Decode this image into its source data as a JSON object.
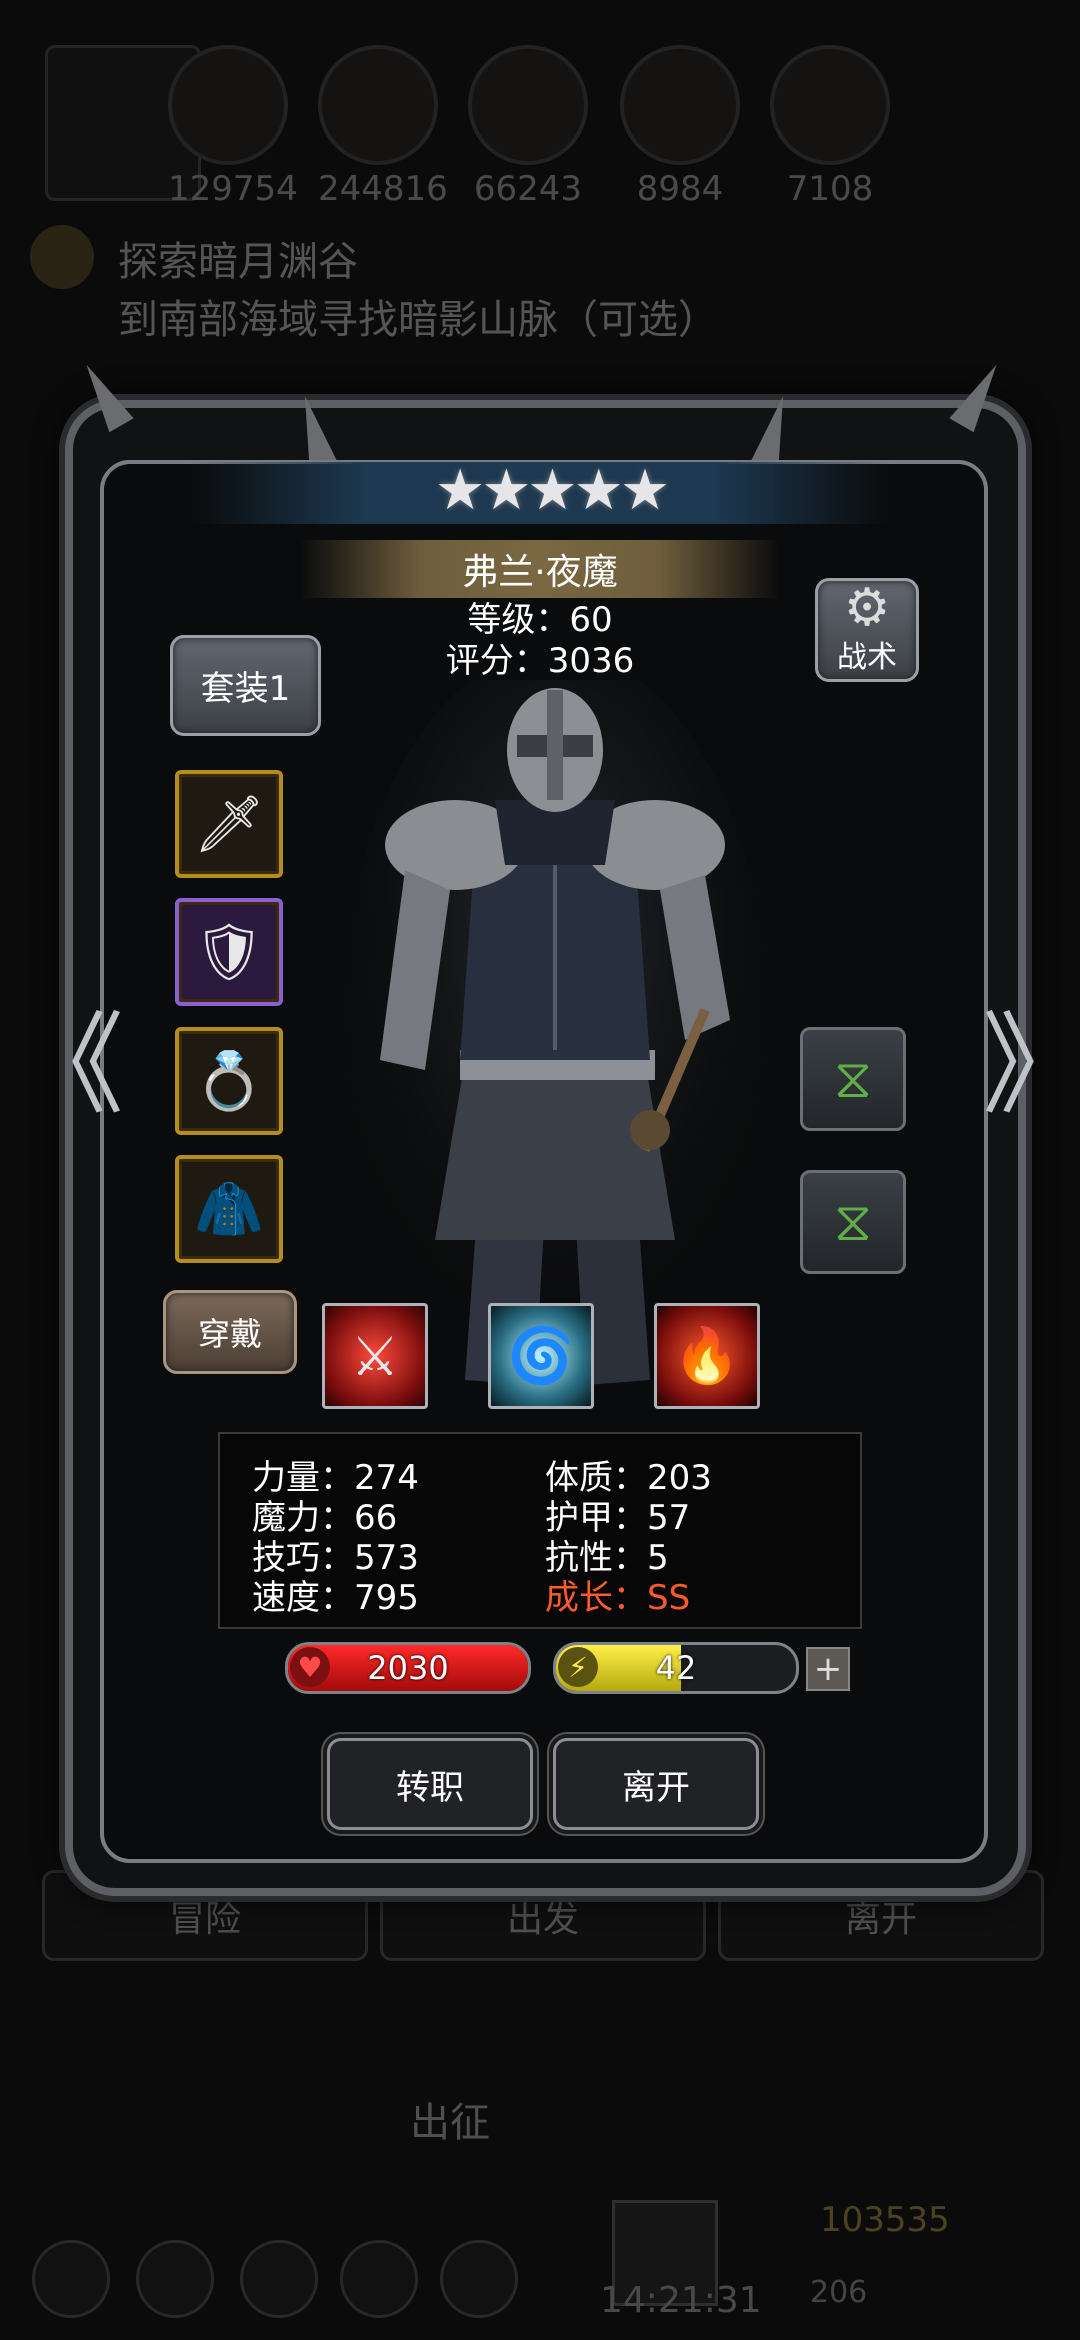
{
  "background": {
    "resources": [
      "129754",
      "244816",
      "66243",
      "8984",
      "7108"
    ],
    "quest_title": "探索暗月渊谷",
    "quest_desc": "到南部海域寻找暗影山脉（可选）",
    "buttons": [
      "冒险",
      "出发",
      "离开"
    ],
    "depart_label": "出征",
    "clock": "14:21:31",
    "gold": "103535",
    "gems": "206"
  },
  "hero": {
    "stars": "★★★★★",
    "name": "弗兰·夜魔",
    "level": "等级：60",
    "score": "评分：3036"
  },
  "controls": {
    "suit_label": "套装1",
    "tactics_label": "战术",
    "wear_label": "穿戴",
    "nav_left": "《",
    "nav_right": "》"
  },
  "equipment": [
    {
      "name": "dagger-icon",
      "glyph": "🗡"
    },
    {
      "name": "armor-icon",
      "glyph": "🛡"
    },
    {
      "name": "ring-icon",
      "glyph": "💍"
    },
    {
      "name": "cloak-icon",
      "glyph": "🧥"
    }
  ],
  "stats": {
    "strength": "力量：274",
    "magic": "魔力：66",
    "skill": "技巧：573",
    "speed": "速度：795",
    "constitution": "体质：203",
    "armor": "护甲：57",
    "resistance": "抗性：5",
    "growth": "成长：SS"
  },
  "bars": {
    "hp_value": "2030",
    "hp_fraction": 1.0,
    "energy_value": "42",
    "energy_fraction": 0.52,
    "plus": "+"
  },
  "actions": {
    "transfer_label": "转职",
    "leave_label": "离开"
  },
  "colors": {
    "growth": "#ff5a2a",
    "hp": "#e01616",
    "energy": "#e6d822",
    "epic": "#8b5fd0",
    "rare": "#b58d1e"
  }
}
